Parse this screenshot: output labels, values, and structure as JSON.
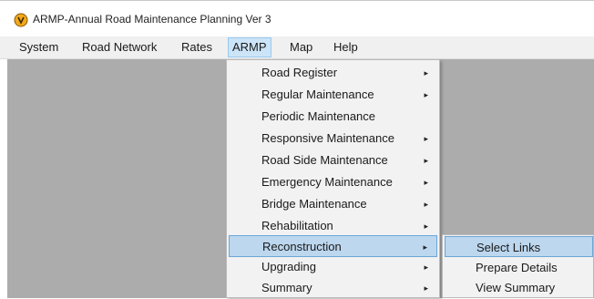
{
  "window": {
    "title": "ARMP-Annual Road Maintenance Planning Ver 3",
    "icon": "app-logo-icon"
  },
  "menubar": {
    "items": [
      {
        "label": "System"
      },
      {
        "label": "Road Network"
      },
      {
        "label": "Rates"
      },
      {
        "label": "ARMP",
        "active": true
      },
      {
        "label": "Map"
      },
      {
        "label": "Help"
      }
    ]
  },
  "armp_menu": {
    "items": [
      {
        "label": "Road Register",
        "has_submenu": true
      },
      {
        "label": "Regular Maintenance",
        "has_submenu": true
      },
      {
        "label": "Periodic Maintenance",
        "has_submenu": false
      },
      {
        "label": "Responsive Maintenance",
        "has_submenu": true
      },
      {
        "label": "Road Side Maintenance",
        "has_submenu": true
      },
      {
        "label": "Emergency Maintenance",
        "has_submenu": true
      },
      {
        "label": "Bridge Maintenance",
        "has_submenu": true
      },
      {
        "label": "Rehabilitation",
        "has_submenu": true
      },
      {
        "label": "Reconstruction",
        "has_submenu": true,
        "highlighted": true
      },
      {
        "label": "Upgrading",
        "has_submenu": true
      },
      {
        "label": "Summary",
        "has_submenu": true
      }
    ],
    "arrow_glyph": "▸"
  },
  "reconstruction_submenu": {
    "items": [
      {
        "label": "Select Links",
        "highlighted": true
      },
      {
        "label": "Prepare Details"
      },
      {
        "label": "View Summary"
      }
    ]
  },
  "colors": {
    "workspace": "#acacac",
    "menu_background": "#f2f2f2",
    "highlight": "#bcd7ee",
    "highlight_border": "#6ba6d6"
  }
}
